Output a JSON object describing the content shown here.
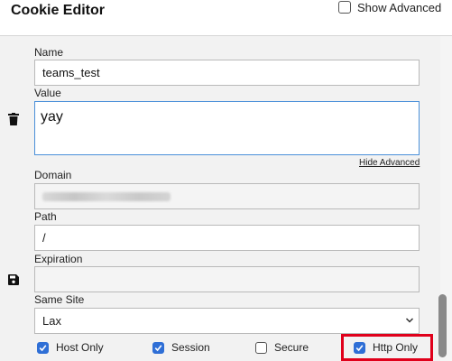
{
  "header": {
    "title": "Cookie Editor",
    "show_advanced_label": "Show Advanced",
    "show_advanced_checked": false
  },
  "form": {
    "name_label": "Name",
    "name_value": "teams_test",
    "value_label": "Value",
    "value_value": "yay",
    "hide_advanced_label": "Hide Advanced",
    "domain_label": "Domain",
    "path_label": "Path",
    "path_value": "/",
    "expiration_label": "Expiration",
    "expiration_value": "",
    "same_site_label": "Same Site",
    "same_site_value": "Lax"
  },
  "checkboxes": [
    {
      "label": "Host Only",
      "checked": true
    },
    {
      "label": "Session",
      "checked": true
    },
    {
      "label": "Secure",
      "checked": false
    },
    {
      "label": "Http Only",
      "checked": true
    }
  ],
  "icons": {
    "delete": "trash-icon",
    "save": "save-icon",
    "dropdown": "chevron-down-icon"
  },
  "colors": {
    "checkbox_checked": "#2f6fd6",
    "highlight": "#e0001b",
    "panel_bg": "#f2f2f2",
    "value_focus_border": "#4a90d9"
  }
}
